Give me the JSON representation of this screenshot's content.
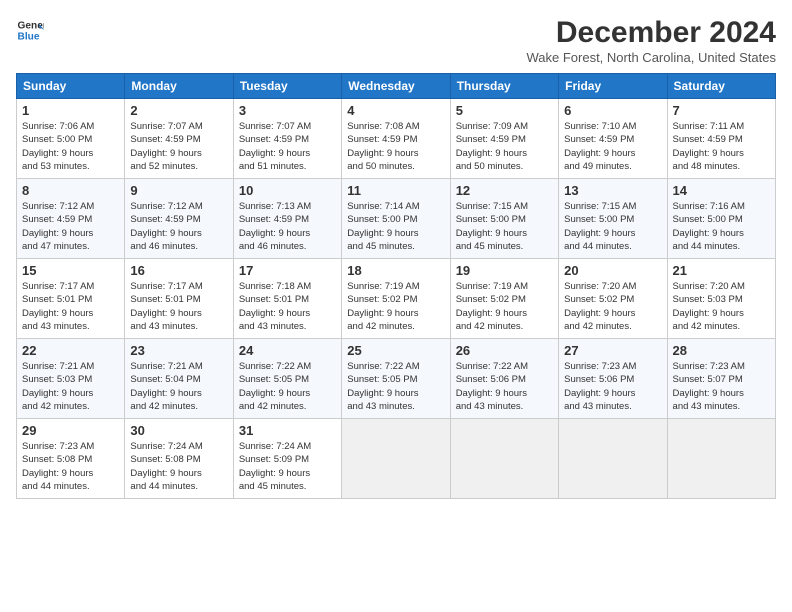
{
  "header": {
    "logo_line1": "General",
    "logo_line2": "Blue",
    "month_title": "December 2024",
    "subtitle": "Wake Forest, North Carolina, United States"
  },
  "weekdays": [
    "Sunday",
    "Monday",
    "Tuesday",
    "Wednesday",
    "Thursday",
    "Friday",
    "Saturday"
  ],
  "weeks": [
    [
      {
        "day": "1",
        "info": "Sunrise: 7:06 AM\nSunset: 5:00 PM\nDaylight: 9 hours\nand 53 minutes."
      },
      {
        "day": "2",
        "info": "Sunrise: 7:07 AM\nSunset: 4:59 PM\nDaylight: 9 hours\nand 52 minutes."
      },
      {
        "day": "3",
        "info": "Sunrise: 7:07 AM\nSunset: 4:59 PM\nDaylight: 9 hours\nand 51 minutes."
      },
      {
        "day": "4",
        "info": "Sunrise: 7:08 AM\nSunset: 4:59 PM\nDaylight: 9 hours\nand 50 minutes."
      },
      {
        "day": "5",
        "info": "Sunrise: 7:09 AM\nSunset: 4:59 PM\nDaylight: 9 hours\nand 50 minutes."
      },
      {
        "day": "6",
        "info": "Sunrise: 7:10 AM\nSunset: 4:59 PM\nDaylight: 9 hours\nand 49 minutes."
      },
      {
        "day": "7",
        "info": "Sunrise: 7:11 AM\nSunset: 4:59 PM\nDaylight: 9 hours\nand 48 minutes."
      }
    ],
    [
      {
        "day": "8",
        "info": "Sunrise: 7:12 AM\nSunset: 4:59 PM\nDaylight: 9 hours\nand 47 minutes."
      },
      {
        "day": "9",
        "info": "Sunrise: 7:12 AM\nSunset: 4:59 PM\nDaylight: 9 hours\nand 46 minutes."
      },
      {
        "day": "10",
        "info": "Sunrise: 7:13 AM\nSunset: 4:59 PM\nDaylight: 9 hours\nand 46 minutes."
      },
      {
        "day": "11",
        "info": "Sunrise: 7:14 AM\nSunset: 5:00 PM\nDaylight: 9 hours\nand 45 minutes."
      },
      {
        "day": "12",
        "info": "Sunrise: 7:15 AM\nSunset: 5:00 PM\nDaylight: 9 hours\nand 45 minutes."
      },
      {
        "day": "13",
        "info": "Sunrise: 7:15 AM\nSunset: 5:00 PM\nDaylight: 9 hours\nand 44 minutes."
      },
      {
        "day": "14",
        "info": "Sunrise: 7:16 AM\nSunset: 5:00 PM\nDaylight: 9 hours\nand 44 minutes."
      }
    ],
    [
      {
        "day": "15",
        "info": "Sunrise: 7:17 AM\nSunset: 5:01 PM\nDaylight: 9 hours\nand 43 minutes."
      },
      {
        "day": "16",
        "info": "Sunrise: 7:17 AM\nSunset: 5:01 PM\nDaylight: 9 hours\nand 43 minutes."
      },
      {
        "day": "17",
        "info": "Sunrise: 7:18 AM\nSunset: 5:01 PM\nDaylight: 9 hours\nand 43 minutes."
      },
      {
        "day": "18",
        "info": "Sunrise: 7:19 AM\nSunset: 5:02 PM\nDaylight: 9 hours\nand 42 minutes."
      },
      {
        "day": "19",
        "info": "Sunrise: 7:19 AM\nSunset: 5:02 PM\nDaylight: 9 hours\nand 42 minutes."
      },
      {
        "day": "20",
        "info": "Sunrise: 7:20 AM\nSunset: 5:02 PM\nDaylight: 9 hours\nand 42 minutes."
      },
      {
        "day": "21",
        "info": "Sunrise: 7:20 AM\nSunset: 5:03 PM\nDaylight: 9 hours\nand 42 minutes."
      }
    ],
    [
      {
        "day": "22",
        "info": "Sunrise: 7:21 AM\nSunset: 5:03 PM\nDaylight: 9 hours\nand 42 minutes."
      },
      {
        "day": "23",
        "info": "Sunrise: 7:21 AM\nSunset: 5:04 PM\nDaylight: 9 hours\nand 42 minutes."
      },
      {
        "day": "24",
        "info": "Sunrise: 7:22 AM\nSunset: 5:05 PM\nDaylight: 9 hours\nand 42 minutes."
      },
      {
        "day": "25",
        "info": "Sunrise: 7:22 AM\nSunset: 5:05 PM\nDaylight: 9 hours\nand 43 minutes."
      },
      {
        "day": "26",
        "info": "Sunrise: 7:22 AM\nSunset: 5:06 PM\nDaylight: 9 hours\nand 43 minutes."
      },
      {
        "day": "27",
        "info": "Sunrise: 7:23 AM\nSunset: 5:06 PM\nDaylight: 9 hours\nand 43 minutes."
      },
      {
        "day": "28",
        "info": "Sunrise: 7:23 AM\nSunset: 5:07 PM\nDaylight: 9 hours\nand 43 minutes."
      }
    ],
    [
      {
        "day": "29",
        "info": "Sunrise: 7:23 AM\nSunset: 5:08 PM\nDaylight: 9 hours\nand 44 minutes."
      },
      {
        "day": "30",
        "info": "Sunrise: 7:24 AM\nSunset: 5:08 PM\nDaylight: 9 hours\nand 44 minutes."
      },
      {
        "day": "31",
        "info": "Sunrise: 7:24 AM\nSunset: 5:09 PM\nDaylight: 9 hours\nand 45 minutes."
      },
      {
        "day": "",
        "info": ""
      },
      {
        "day": "",
        "info": ""
      },
      {
        "day": "",
        "info": ""
      },
      {
        "day": "",
        "info": ""
      }
    ]
  ]
}
